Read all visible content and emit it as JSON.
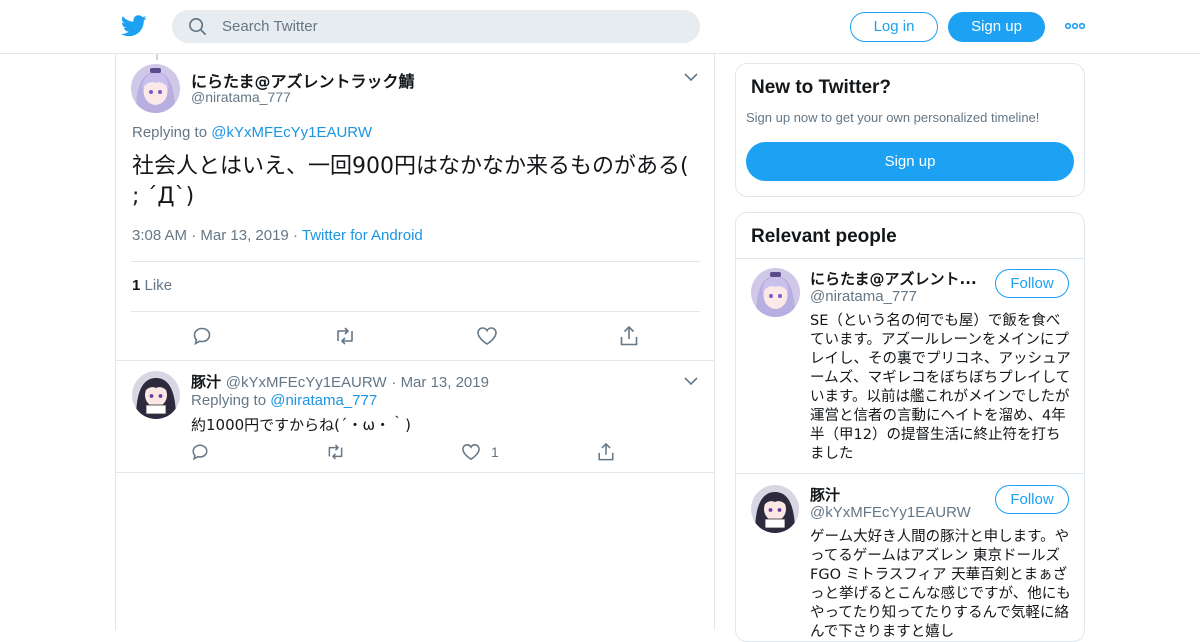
{
  "header": {
    "search_placeholder": "Search Twitter",
    "login_label": "Log in",
    "signup_label": "Sign up"
  },
  "tweet": {
    "display_name": "にらたま@アズレントラック鯖",
    "handle": "@niratama_777",
    "replying_prefix": "Replying to",
    "replying_to": "@kYxMFEcYy1EAURW",
    "text": "社会人とはいえ、一回900円はなかなか来るものがある( ; ´Д`)",
    "time": "3:08 AM",
    "date": "Mar 13, 2019",
    "source": "Twitter for Android",
    "like_count": "1",
    "like_label": "Like"
  },
  "reply": {
    "display_name": "豚汁",
    "handle": "@kYxMFEcYy1EAURW",
    "date": "Mar 13, 2019",
    "replying_prefix": "Replying to",
    "replying_to": "@niratama_777",
    "text": "約1000円ですからね(´・ω・｀)",
    "like_count": "1"
  },
  "sidebar": {
    "new_title": "New to Twitter?",
    "new_subtitle": "Sign up now to get your own personalized timeline!",
    "new_signup": "Sign up",
    "people_title": "Relevant people",
    "people": [
      {
        "name": "にらたま@アズレント...",
        "handle": "@niratama_777",
        "follow": "Follow",
        "bio": "SE（という名の何でも屋）で飯を食べています。アズールレーンをメインにプレイし、その裏でプリコネ、アッシュアームズ、マギレコをぼちぼちプレイしています。以前は艦これがメインでしたが運営と信者の言動にヘイトを溜め、4年半（甲12）の提督生活に終止符を打ちました"
      },
      {
        "name": "豚汁",
        "handle": "@kYxMFEcYy1EAURW",
        "follow": "Follow",
        "bio": "ゲーム大好き人間の豚汁と申します。やってるゲームはアズレン 東京ドールズ FGO ミトラスフィア 天華百剣とまぁざっと挙げるとこんな感じですが、他にもやってたり知ってたりするんで気軽に絡んで下さりますと嬉し"
      }
    ]
  },
  "colors": {
    "brand": "#1da1f2",
    "link": "#1b95e0",
    "muted": "#657786",
    "border": "#e1e8ed"
  },
  "icons": [
    "twitter-logo-icon",
    "search-icon",
    "more-icon",
    "chevron-down-icon",
    "reply-icon",
    "retweet-icon",
    "like-icon",
    "share-icon"
  ]
}
